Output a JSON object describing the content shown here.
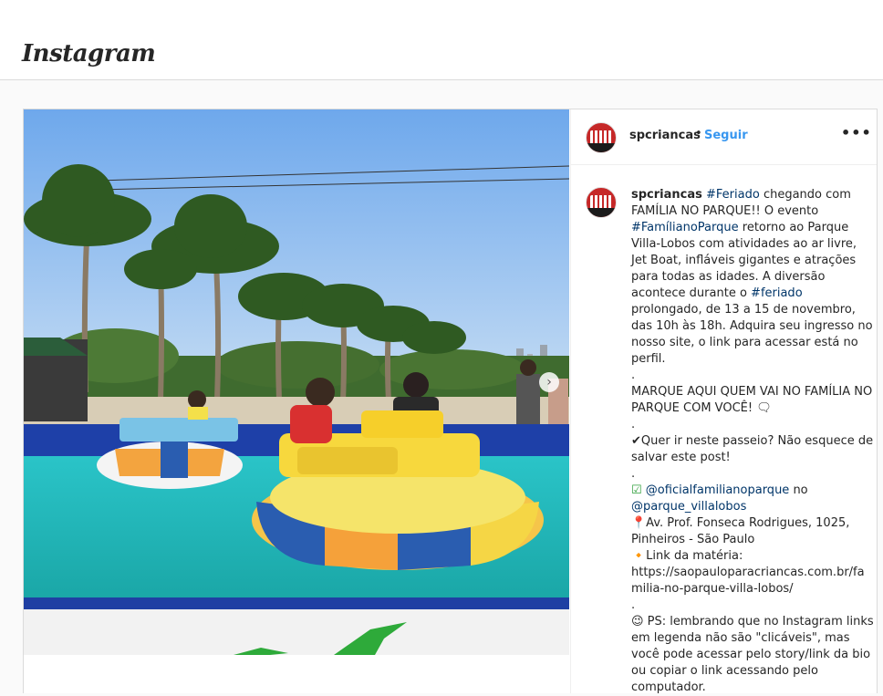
{
  "app": {
    "logo": "Instagram"
  },
  "post": {
    "username": "spcriancas",
    "separator": "•",
    "follow_label": "Seguir",
    "more_label": "•••",
    "carousel_next": "›",
    "caption": {
      "username": "spcriancas",
      "line1_tag1": "#Feriado",
      "line1_text": " chegando com FAMÍLIA NO PARQUE!! O evento ",
      "line1_tag2": "#FamílianoParque",
      "line1_text2": " retorno ao Parque Villa-Lobos com atividades ao ar livre, Jet Boat, infláveis gigantes e atrações para todas as idades. A diversão acontece durante o ",
      "line1_tag3": "#feriado",
      "line1_text3": " prolongado, de 13 a 15 de novembro, das 10h às 18h. Adquira seu ingresso no nosso site, o link para acessar está no perfil.",
      "dot1": ".",
      "para2": "MARQUE AQUI QUEM VAI NO FAMÍLIA NO PARQUE COM VOCÊ! 🗨",
      "dot2": ".",
      "para3": "✔Quer ir neste passeio? Não esquece de salvar este post!",
      "dot3": ".",
      "para4_icon": "☑",
      "para4_mention1": "@oficialfamilianoparque",
      "para4_text": " no ",
      "para4_mention2": "@parque_villalobos",
      "para5": "📍Av. Prof. Fonseca Rodrigues, 1025, Pinheiros - São Paulo",
      "para6": "🔸Link da matéria:",
      "para7": "https://saopauloparacriancas.com.br/familia-no-parque-villa-lobos/",
      "dot4": ".",
      "para8": "😉 PS: lembrando que no Instagram links em legenda não são \"clicáveis\", mas você pode acessar pelo story/link da bio ou copiar o link acessando pelo computador."
    }
  },
  "colors": {
    "accent": "#3897f0",
    "tag": "#003569",
    "border": "#dbdbdb",
    "background": "#fafafa"
  }
}
